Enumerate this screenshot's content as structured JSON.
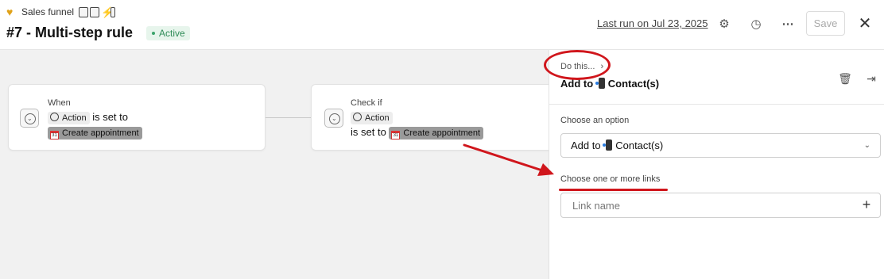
{
  "header": {
    "breadcrumb": "Sales funnel",
    "title": "#7 - Multi-step rule",
    "status": "Active",
    "last_run": "Last run on Jul 23, 2025",
    "save_label": "Save"
  },
  "icons": {
    "settings": "gear-icon",
    "history": "clock-icon",
    "more": "more-horizontal-icon",
    "close": "close-icon"
  },
  "canvas": {
    "node1": {
      "label": "When",
      "chip": "Action",
      "text": "is set to",
      "value": "Create appointment"
    },
    "node2": {
      "label": "Check if",
      "chip": "Action",
      "text": "is set to",
      "value": "Create appointment"
    }
  },
  "panel": {
    "breadcrumb": "Do this...",
    "title_prefix": "Add to",
    "title_object": "Contact(s)",
    "choose_option_label": "Choose an option",
    "option_prefix": "Add to",
    "option_object": "Contact(s)",
    "links_label": "Choose one or more links",
    "link_placeholder": "Link name"
  },
  "colors": {
    "annotation": "#d0161c",
    "active_badge_bg": "#e7f5ec",
    "active_badge_text": "#2e8b57",
    "canvas_bg": "#f1f1f1"
  }
}
